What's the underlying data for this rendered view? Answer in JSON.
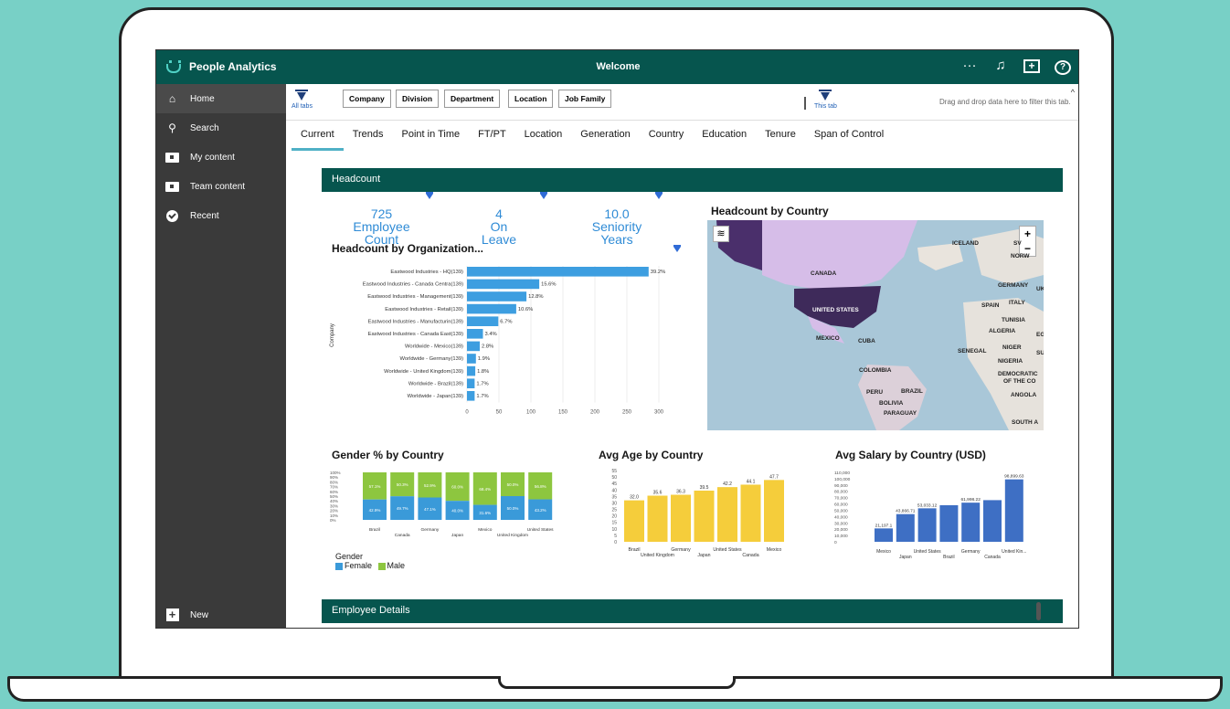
{
  "app": {
    "title": "People Analytics",
    "page_title": "Welcome",
    "more_icon": "more-horizontal-icon",
    "bell_icon": "bell-icon",
    "feedback_icon": "feedback-icon",
    "help_icon": "help-icon"
  },
  "sidebar": {
    "items": [
      {
        "label": "Home",
        "icon": "home-icon"
      },
      {
        "label": "Search",
        "icon": "search-icon"
      },
      {
        "label": "My content",
        "icon": "folder-icon"
      },
      {
        "label": "Team content",
        "icon": "team-folder-icon"
      },
      {
        "label": "Recent",
        "icon": "clock-icon"
      }
    ],
    "new_label": "New"
  },
  "filters": {
    "all_tabs_label": "All tabs",
    "chips": [
      "Company",
      "Division",
      "Department",
      "Location",
      "Job Family"
    ],
    "this_tab_label": "This tab",
    "drop_hint": "Drag and drop data here to filter this tab."
  },
  "tabs": [
    "Current",
    "Trends",
    "Point in Time",
    "FT/PT",
    "Location",
    "Generation",
    "Country",
    "Education",
    "Tenure",
    "Span of Control"
  ],
  "active_tab": "Current",
  "headcount_section": {
    "title": "Headcount",
    "kpis": [
      {
        "value": "725",
        "label": "Employee Count"
      },
      {
        "value": "4",
        "label": "On Leave"
      },
      {
        "value": "10.0",
        "label": "Seniority Years"
      }
    ]
  },
  "map": {
    "title": "Headcount by Country",
    "labels": [
      "ICELAND",
      "SV",
      "NORW",
      "CANADA",
      "GERMANY",
      "UK",
      "SPAIN",
      "ITALY",
      "UNITED STATES",
      "TUNISIA",
      "ALGERIA",
      "EG",
      "MEXICO",
      "CUBA",
      "SENEGAL",
      "NIGER",
      "SU",
      "NIGERIA",
      "COLOMBIA",
      "DEMOCRATIC",
      "OF THE CO",
      "PERU",
      "BRAZIL",
      "ANGOLA",
      "BOLIVIA",
      "PARAGUAY",
      "SOUTH A"
    ],
    "zoom_in": "+",
    "zoom_out": "−"
  },
  "employee_details": {
    "title": "Employee Details"
  },
  "colors": {
    "brand": "#06554e",
    "bar_blue": "#3d9ee0",
    "female": "#3a9ad9",
    "male": "#8dc63f",
    "age_bar": "#f5cd3b",
    "salary_bar": "#3e6fc4",
    "kpi": "#2f8bd6"
  },
  "chart_data": [
    {
      "type": "bar",
      "orientation": "horizontal",
      "title": "Headcount by Organization...",
      "ylabel": "Company",
      "categories": [
        "Eastwood Industries - HQ(139)",
        "Eastwood Industries - Canada Centra(139)",
        "Eastwood Industries - Management(139)",
        "Eastwood Industries - Retail(139)",
        "Eastwood Industries - Manufacturin(139)",
        "Eastwood Industries - Canada East(139)",
        "Worldwide - Mexico(139)",
        "Worldwide - Germany(139)",
        "Worldwide - United Kingdom(139)",
        "Worldwide - Brazil(139)",
        "Worldwide - Japan(139)"
      ],
      "values": [
        284,
        113,
        93,
        77,
        49,
        25,
        20,
        14,
        13,
        12,
        12
      ],
      "data_labels": [
        "39.2%",
        "15.6%",
        "12.8%",
        "10.6%",
        "6.7%",
        "3.4%",
        "2.8%",
        "1.9%",
        "1.8%",
        "1.7%",
        "1.7%"
      ],
      "xticks": [
        "0",
        "50",
        "100",
        "150",
        "200",
        "250",
        "300"
      ],
      "xlim": [
        0,
        300
      ]
    },
    {
      "type": "bar",
      "stacked": true,
      "title": "Gender % by Country",
      "legend_title": "Gender",
      "categories": [
        "Brazil",
        "Canada",
        "Germany",
        "Japan",
        "Mexico",
        "United Kingdom",
        "United States"
      ],
      "series": [
        {
          "name": "Female",
          "values": [
            42.9,
            49.7,
            47.1,
            40.0,
            31.6,
            50.0,
            43.2
          ]
        },
        {
          "name": "Male",
          "values": [
            57.1,
            50.3,
            52.9,
            60.0,
            68.4,
            50.0,
            56.8
          ]
        }
      ],
      "data_labels_female": [
        "42.9%",
        "49.7%",
        "47.1%",
        "40.0%",
        "31.6%",
        "50.0%",
        "43.2%"
      ],
      "data_labels_male": [
        "57.1%",
        "50.3%",
        "52.9%",
        "60.0%",
        "68.4%",
        "50.0%",
        "56.8%"
      ],
      "yticks": [
        "100%",
        "90%",
        "80%",
        "70%",
        "60%",
        "50%",
        "40%",
        "30%",
        "20%",
        "10%",
        "0%"
      ],
      "ylim": [
        0,
        100
      ]
    },
    {
      "type": "bar",
      "title": "Avg Age by Country",
      "categories": [
        "Brazil",
        "United Kingdom",
        "Germany",
        "Japan",
        "United States",
        "Canada",
        "Mexico"
      ],
      "values": [
        32.0,
        35.6,
        36.3,
        39.5,
        42.2,
        44.1,
        47.7
      ],
      "data_labels": [
        "32.0",
        "35.6",
        "36.3",
        "39.5",
        "42.2",
        "44.1",
        "47.7"
      ],
      "yticks": [
        "55",
        "50",
        "45",
        "40",
        "35",
        "30",
        "25",
        "20",
        "15",
        "10",
        "5",
        "0"
      ],
      "ylim": [
        0,
        55
      ]
    },
    {
      "type": "bar",
      "title": "Avg Salary by Country (USD)",
      "categories": [
        "Mexico",
        "Japan",
        "United States",
        "Brazil",
        "Germany",
        "Canada",
        "United Kin..."
      ],
      "values": [
        21197.1,
        43866.71,
        53033.12,
        58000,
        61998.22,
        66000,
        98899.63
      ],
      "data_labels": [
        "21,197.1",
        "43,866.71",
        "53,033.12",
        "",
        "61,998.22",
        "",
        "98,899.63"
      ],
      "yticks": [
        "110,000",
        "100,000",
        "90,000",
        "80,000",
        "70,000",
        "60,000",
        "50,000",
        "40,000",
        "30,000",
        "20,000",
        "10,000",
        "0"
      ],
      "ylim": [
        0,
        110000
      ]
    }
  ]
}
